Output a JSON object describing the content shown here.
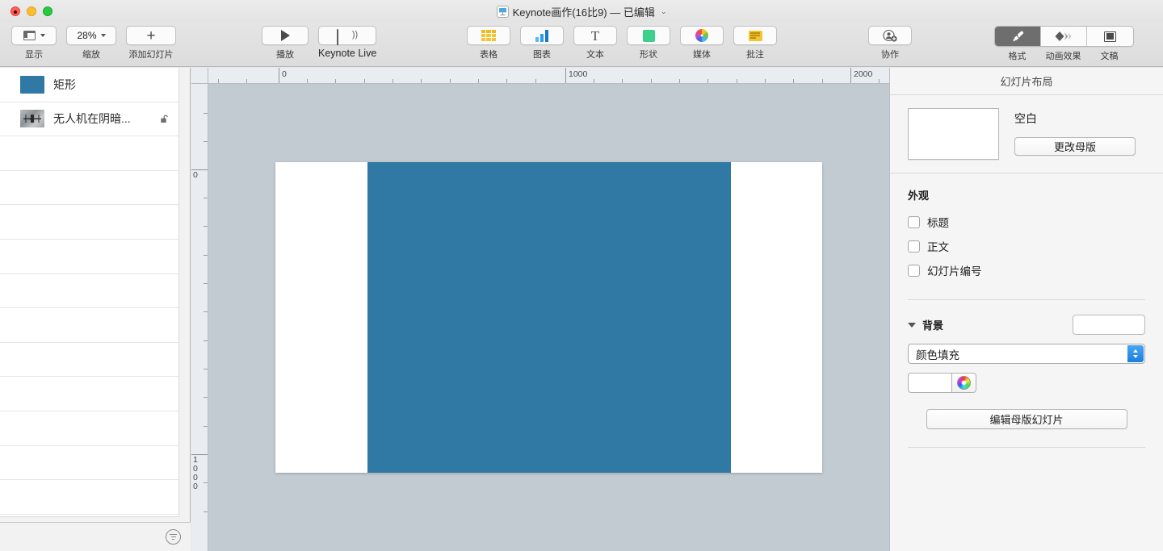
{
  "window": {
    "title": "Keynote画作(16比9) — 已编辑",
    "title_chevron": "⌄",
    "app_icon": "keynote-icon"
  },
  "toolbar": {
    "view": {
      "label": "显示",
      "icon": "view-layout-icon"
    },
    "zoom": {
      "label": "缩放",
      "value": "28%"
    },
    "add_slide": {
      "label": "添加幻灯片",
      "icon": "plus-icon"
    },
    "play": {
      "label": "播放",
      "icon": "play-triangle-icon"
    },
    "live": {
      "label": "Keynote Live",
      "icon": "screen-broadcast-icon"
    },
    "insert": [
      {
        "label": "表格",
        "icon": "table-icon"
      },
      {
        "label": "图表",
        "icon": "chart-bars-icon"
      },
      {
        "label": "文本",
        "icon": "text-T-icon"
      },
      {
        "label": "形状",
        "icon": "shape-square-icon"
      },
      {
        "label": "媒体",
        "icon": "media-photos-icon"
      },
      {
        "label": "批注",
        "icon": "comment-icon"
      }
    ],
    "collaborate": {
      "label": "协作",
      "icon": "add-person-icon"
    },
    "panels": [
      {
        "label": "格式",
        "icon": "paintbrush-icon",
        "active": true
      },
      {
        "label": "动画效果",
        "icon": "diamond-animate-icon",
        "active": false
      },
      {
        "label": "文稿",
        "icon": "document-frame-icon",
        "active": false
      }
    ]
  },
  "object_list": {
    "items": [
      {
        "name": "矩形",
        "thumb": "blue-rectangle-thumb",
        "locked": false,
        "has_lock_icon": false
      },
      {
        "name": "无人机在阴暗...",
        "thumb": "drone-photo-thumb",
        "locked": false,
        "has_lock_icon": true
      }
    ],
    "empty_row_count": 11,
    "footer_icon": "filter-sort-icon"
  },
  "canvas": {
    "ruler_h": {
      "labels": [
        "0",
        "1000",
        "2000"
      ],
      "positions": [
        345,
        700,
        1053
      ]
    },
    "ruler_v": {
      "labels": [
        "0",
        "1000"
      ],
      "positions": [
        210,
        560
      ]
    },
    "slide": {
      "background_color": "#ffffff",
      "shape": {
        "name": "矩形",
        "fill": "#3179a5"
      }
    }
  },
  "inspector": {
    "title": "幻灯片布局",
    "master": {
      "name": "空白",
      "change_button": "更改母版"
    },
    "appearance": {
      "heading": "外观",
      "checkboxes": [
        {
          "label": "标题",
          "checked": false
        },
        {
          "label": "正文",
          "checked": false
        },
        {
          "label": "幻灯片编号",
          "checked": false
        }
      ]
    },
    "background": {
      "heading": "背景",
      "expanded": true,
      "fill_type": "颜色填充",
      "color": "#ffffff",
      "color_wheel_icon": "color-wheel-icon"
    },
    "edit_master_button": "编辑母版幻灯片"
  }
}
